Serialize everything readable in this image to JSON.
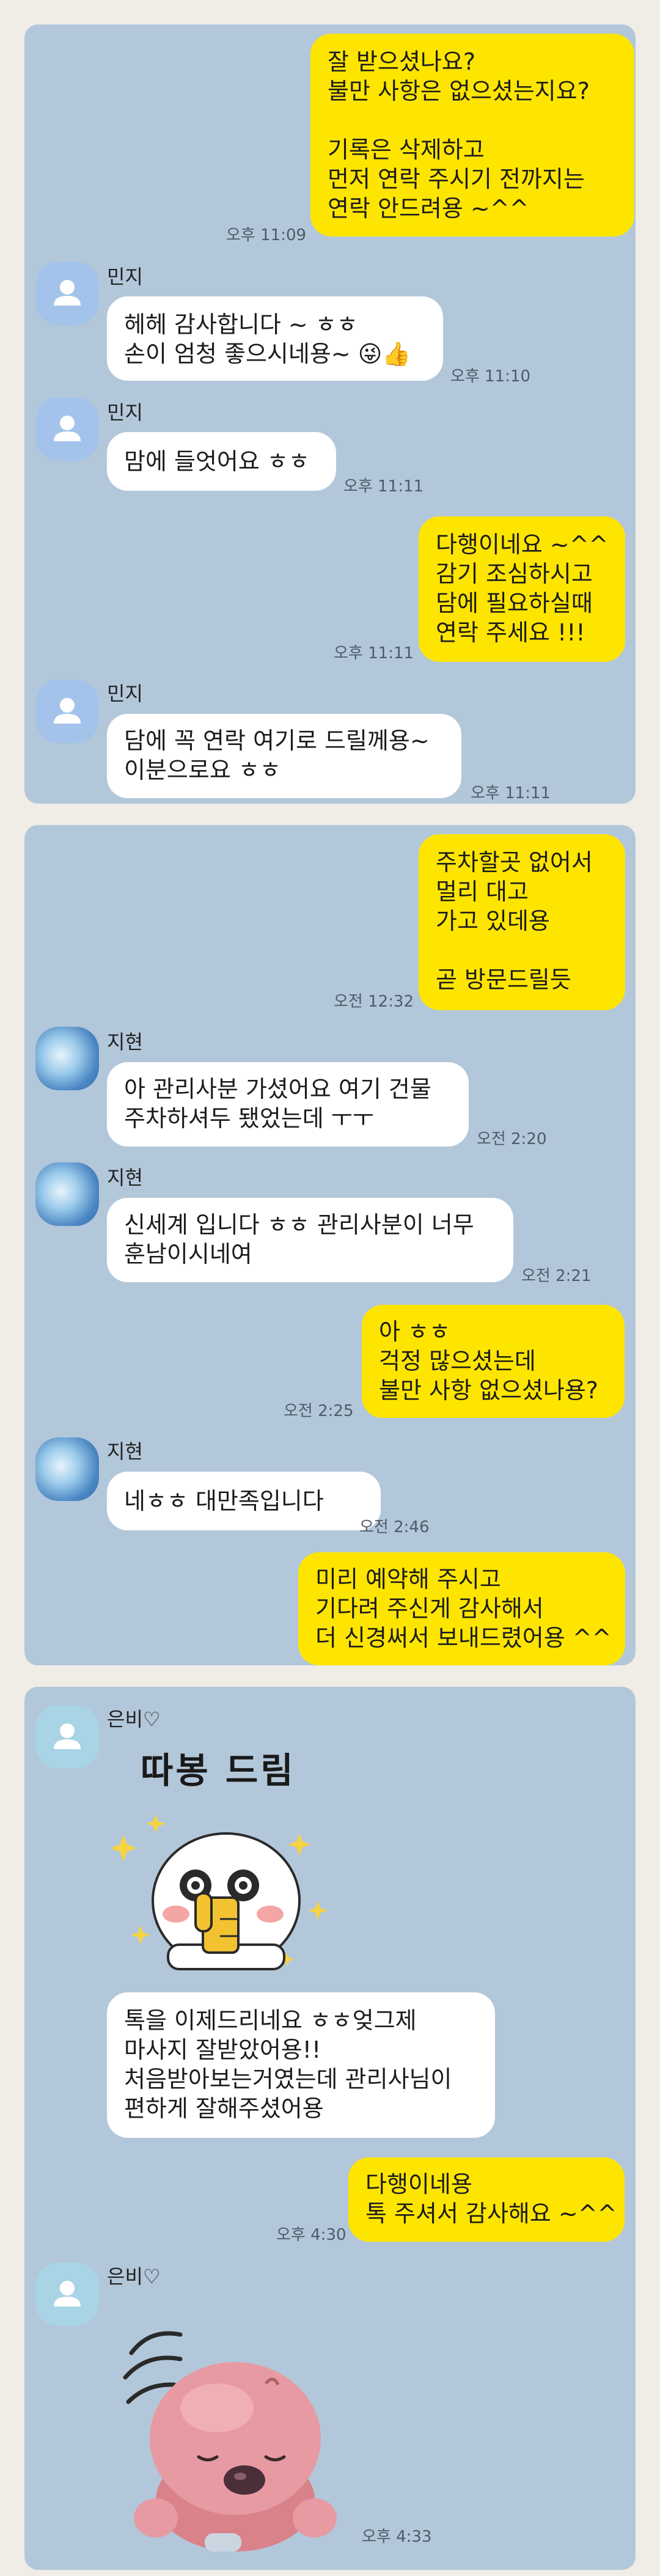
{
  "colors": {
    "my_bubble": "#fee500",
    "their_bubble": "#ffffff",
    "chat_bg": "#b3c7da"
  },
  "sections": [
    {
      "messages": [
        {
          "from": "me",
          "text": "잘 받으셨나요?\n불만 사항은 없으셨는지요?\n\n기록은 삭제하고\n먼저 연락 주시기 전까지는\n연락 안드려용 ~^^",
          "time": "오후 11:09"
        },
        {
          "from": "민지",
          "name": "민지",
          "text": "헤헤 감사합니다 ~ ㅎㅎ\n손이 엄청 좋으시네용~ 😜👍",
          "time": "오후 11:10"
        },
        {
          "from": "민지",
          "name": "민지",
          "text": "맘에 들엇어요 ㅎㅎ",
          "time": "오후 11:11"
        },
        {
          "from": "me",
          "text": "다행이네요 ~^^\n감기 조심하시고\n담에 필요하실때\n연락 주세요 !!!",
          "time": "오후 11:11"
        },
        {
          "from": "민지",
          "name": "민지",
          "text": "담에 꼭 연락 여기로 드릴께용~\n이분으로요 ㅎㅎ",
          "time": "오후 11:11"
        }
      ]
    },
    {
      "messages": [
        {
          "from": "me",
          "text": "주차할곳 없어서\n멀리 대고\n가고 있데용\n\n곧 방문드릴듯",
          "time": "오전 12:32"
        },
        {
          "from": "지현",
          "name": "지현",
          "text": "아 관리사분 가셨어요 여기 건물\n주차하셔두 됐었는데 ㅜㅜ",
          "time": "오전 2:20"
        },
        {
          "from": "지현",
          "name": "지현",
          "text": "신세계 입니다 ㅎㅎ 관리사분이 너무\n훈남이시네여",
          "time": "오전 2:21"
        },
        {
          "from": "me",
          "text": "아 ㅎㅎ\n걱정 많으셨는데\n불만 사항 없으셨나용?",
          "time": "오전 2:25"
        },
        {
          "from": "지현",
          "name": "지현",
          "text": "네ㅎㅎ 대만족입니다",
          "time": "오전 2:46"
        },
        {
          "from": "me",
          "text": "미리 예약해 주시고\n기다려 주신게 감사해서\n더 신경써서 보내드렸어용 ^^",
          "time": ""
        }
      ]
    },
    {
      "messages": [
        {
          "from": "은비",
          "name": "은비♡",
          "sticker": "thumbs-up-character",
          "sticker_text": "따봉 드림"
        },
        {
          "from": "은비",
          "text": "톡을 이제드리네요 ㅎㅎ엊그제\n마사지 잘받았어용!!\n처음받아보는거였는데 관리사님이\n편하게 잘해주셨어용",
          "time": ""
        },
        {
          "from": "me",
          "text": "다행이네용\n톡 주셔서 감사해요 ~^^",
          "time": "오후 4:30"
        },
        {
          "from": "은비",
          "name": "은비♡",
          "sticker": "pink-beaver-bowing",
          "time": "오후 4:33"
        }
      ]
    }
  ]
}
